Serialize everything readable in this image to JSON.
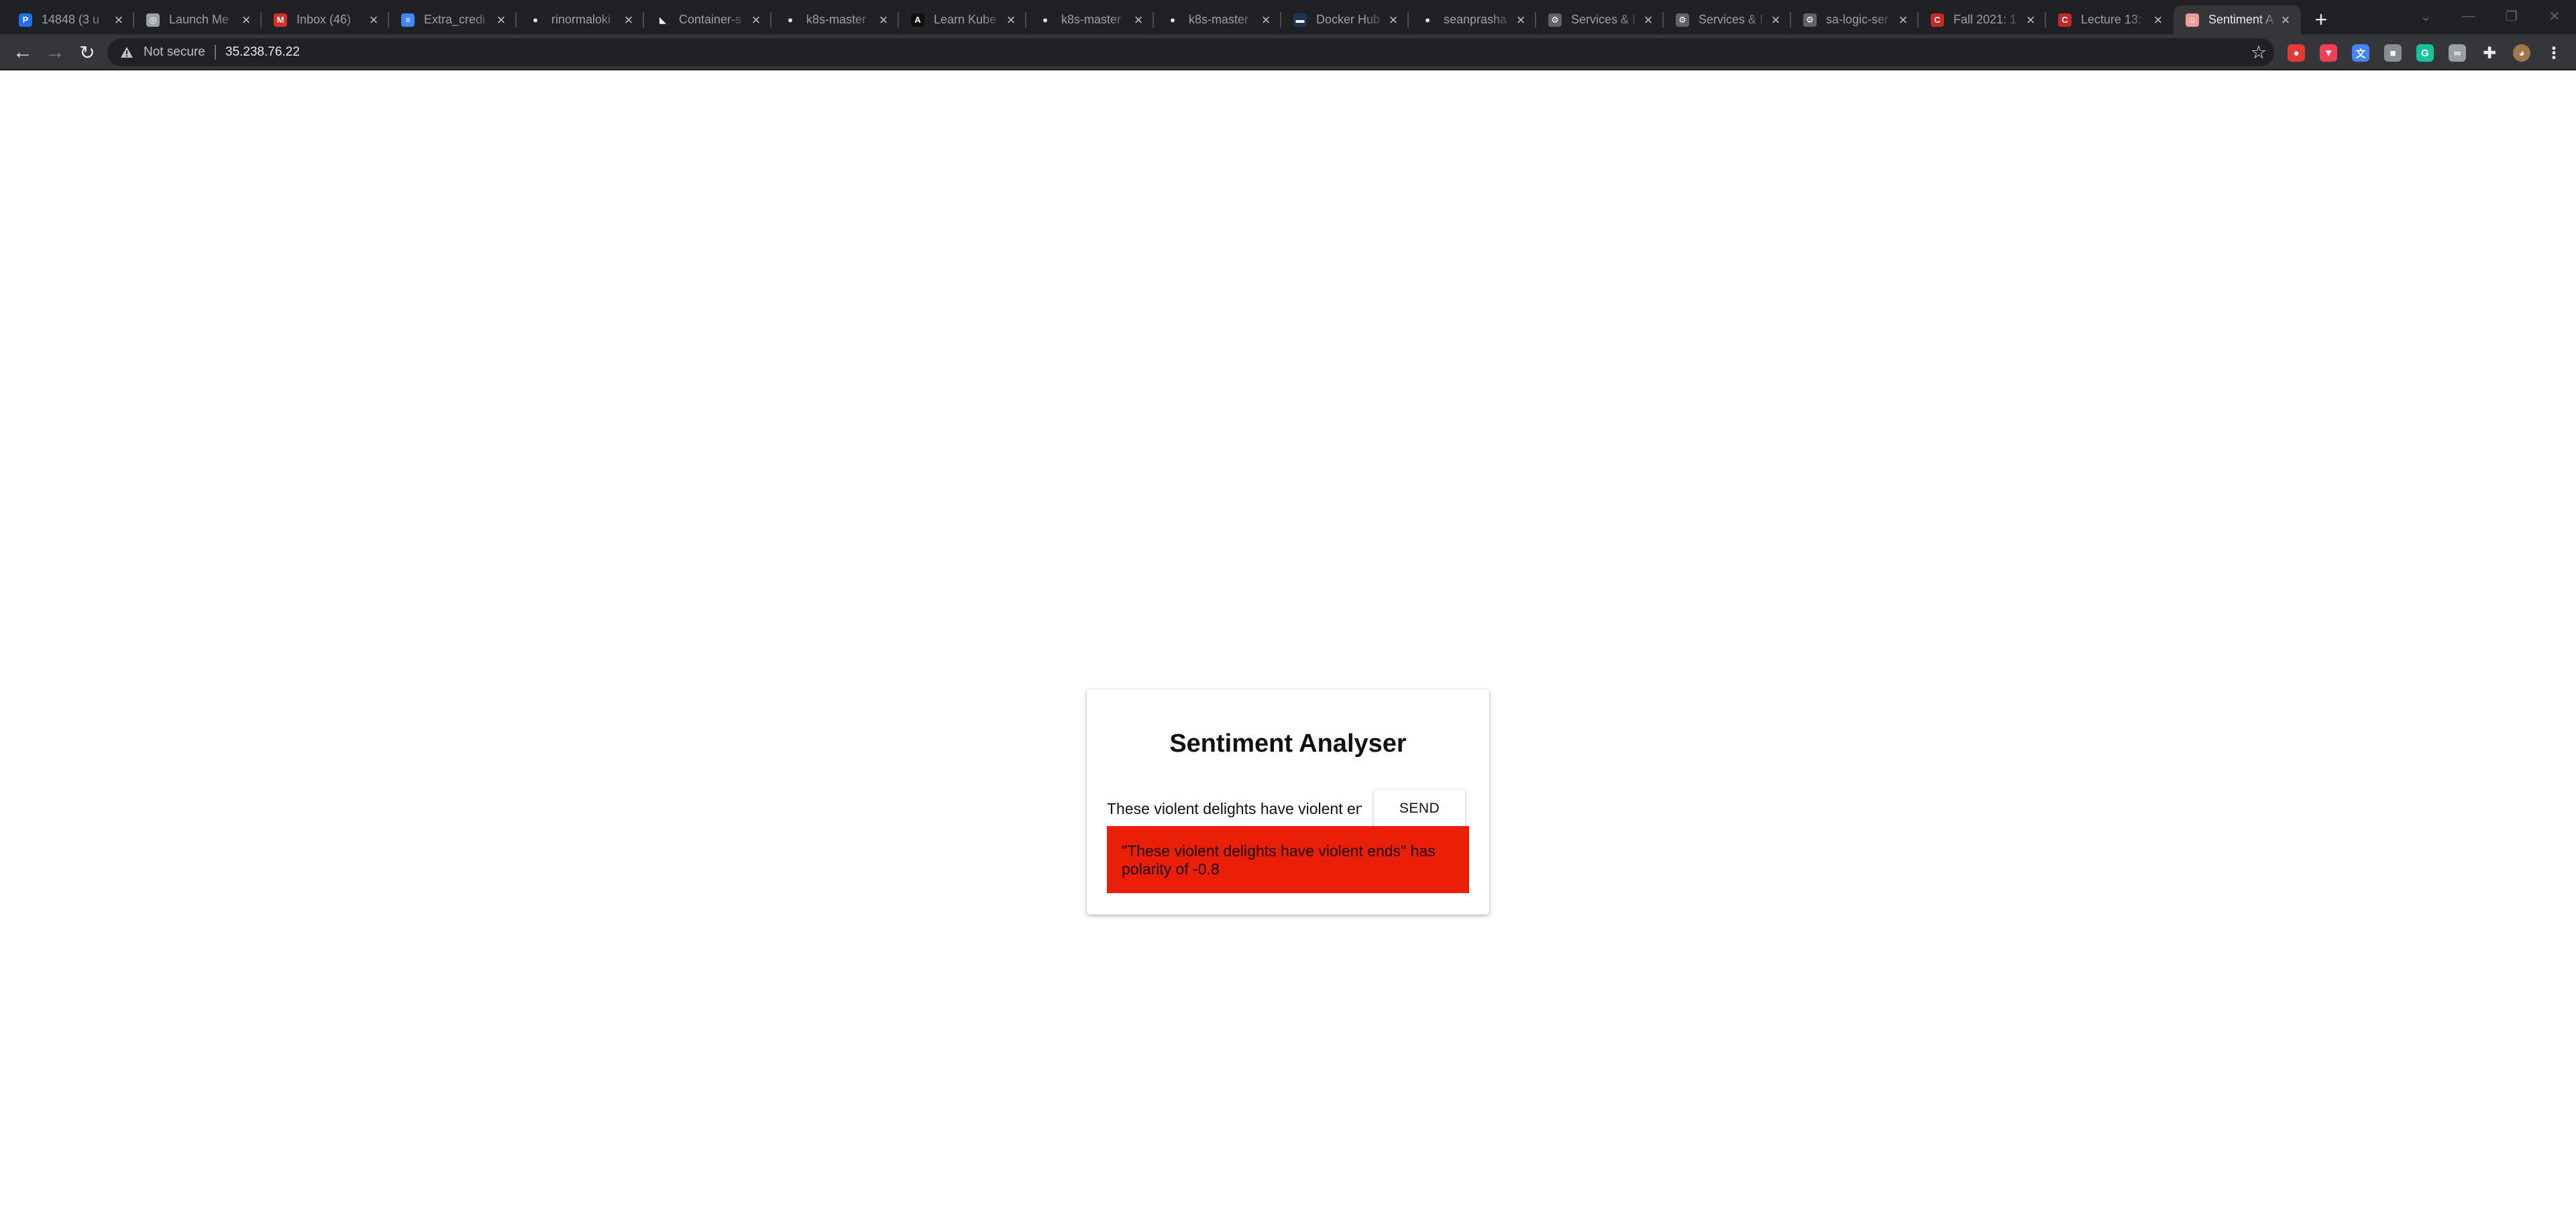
{
  "browser": {
    "tabs": [
      {
        "title": "14848 (3 u",
        "icon": "p-icon",
        "icon_color": "#1f6feb",
        "glyph": "P"
      },
      {
        "title": "Launch Me",
        "icon": "globe-icon",
        "icon_color": "#9aa0a6",
        "glyph": "◎"
      },
      {
        "title": "Inbox (46)",
        "icon": "gmail-icon",
        "icon_color": "#d93025",
        "glyph": "M"
      },
      {
        "title": "Extra_credi",
        "icon": "docs-icon",
        "icon_color": "#4285f4",
        "glyph": "≡"
      },
      {
        "title": "rinormaloki",
        "icon": "github-icon",
        "icon_color": "#202124",
        "glyph": "●"
      },
      {
        "title": "Container-s",
        "icon": "container-icon",
        "icon_color": "#202124",
        "glyph": "◣"
      },
      {
        "title": "k8s-master",
        "icon": "github-icon",
        "icon_color": "#202124",
        "glyph": "●"
      },
      {
        "title": "Learn Kube",
        "icon": "learn-icon",
        "icon_color": "#111111",
        "glyph": "A"
      },
      {
        "title": "k8s-master",
        "icon": "github-icon",
        "icon_color": "#202124",
        "glyph": "●"
      },
      {
        "title": "k8s-master",
        "icon": "github-icon",
        "icon_color": "#202124",
        "glyph": "●"
      },
      {
        "title": "Docker Hub",
        "icon": "docker-icon",
        "icon_color": "#1d3557",
        "glyph": "▬"
      },
      {
        "title": "seanprasha",
        "icon": "github-icon",
        "icon_color": "#202124",
        "glyph": "●"
      },
      {
        "title": "Services & I",
        "icon": "kube-icon",
        "icon_color": "#5f6368",
        "glyph": "⚙"
      },
      {
        "title": "Services & I",
        "icon": "kube-icon",
        "icon_color": "#5f6368",
        "glyph": "⚙"
      },
      {
        "title": "sa-logic-ser",
        "icon": "kube-icon",
        "icon_color": "#5f6368",
        "glyph": "⚙"
      },
      {
        "title": "Fall 2021: 1",
        "icon": "canvas-icon",
        "icon_color": "#c62828",
        "glyph": "C"
      },
      {
        "title": "Lecture 13:",
        "icon": "canvas-icon",
        "icon_color": "#c62828",
        "glyph": "C"
      },
      {
        "title": "Sentiment A",
        "icon": "sentiment-icon",
        "icon_color": "#ef9a9a",
        "glyph": "☺",
        "active": true
      }
    ],
    "address": {
      "security_label": "Not secure",
      "url": "35.238.76.22"
    },
    "extensions": [
      {
        "icon": "adblock-icon",
        "color": "#e53935",
        "glyph": "●"
      },
      {
        "icon": "pocket-icon",
        "color": "#ef4056",
        "glyph": "▼"
      },
      {
        "icon": "translate-icon",
        "color": "#4285f4",
        "glyph": "文"
      },
      {
        "icon": "extension-grey-icon",
        "color": "#8a8d91",
        "glyph": "■"
      },
      {
        "icon": "grammarly-icon",
        "color": "#15c39a",
        "glyph": "G"
      },
      {
        "icon": "incognito-icon",
        "color": "#9aa0a6",
        "glyph": "∞"
      },
      {
        "icon": "puzzle-icon",
        "color": "#35363a",
        "glyph": "✚"
      },
      {
        "icon": "profile-avatar-icon",
        "color": "#a0784a",
        "glyph": "◕"
      },
      {
        "icon": "menu-icon",
        "color": "#35363a",
        "glyph": "⋮"
      }
    ]
  },
  "app": {
    "title": "Sentiment Analyser",
    "input_value": "These violent delights have violent ends",
    "send_label": "SEND",
    "result_text": "\"These violent delights have violent ends\" has polarity of -0.8",
    "result_color": "#ea1f08"
  }
}
